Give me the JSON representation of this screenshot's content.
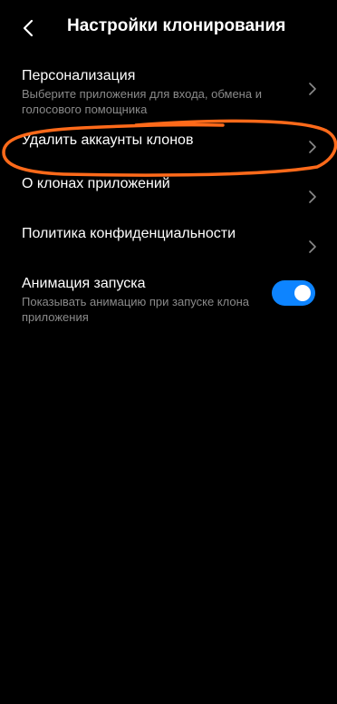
{
  "header": {
    "title": "Настройки клонирования",
    "back_icon": "chevron-left-icon"
  },
  "settings": {
    "personalization": {
      "title": "Персонализация",
      "subtitle": "Выберите приложения для входа, обмена и голосового помощника"
    },
    "delete_clones": {
      "title": "Удалить аккаунты клонов"
    },
    "about_clones": {
      "title": "О клонах приложений"
    },
    "privacy_policy": {
      "title": "Политика конфиденциальности"
    },
    "launch_animation": {
      "title": "Анимация запуска",
      "subtitle": "Показывать анимацию при запуске клона приложения",
      "enabled": true
    }
  },
  "colors": {
    "background": "#000000",
    "text_primary": "#ffffff",
    "text_secondary": "#8a8a8a",
    "chevron": "#8a8a8a",
    "toggle_on": "#0d84ff",
    "annotation": "#ff6a1a"
  },
  "icons": {
    "row_chevron": "chevron-right-icon"
  }
}
